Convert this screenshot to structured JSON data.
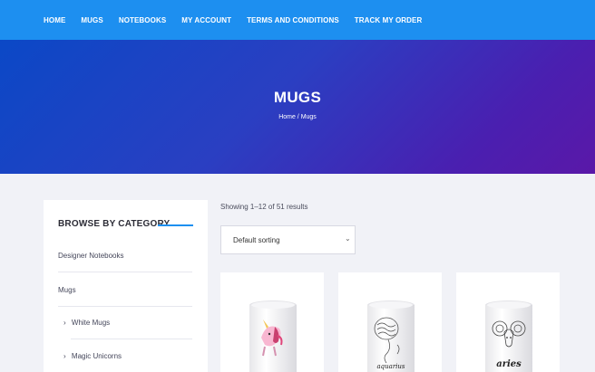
{
  "nav": {
    "items": [
      "HOME",
      "MUGS",
      "NOTEBOOKS",
      "MY ACCOUNT",
      "TERMS AND CONDITIONS",
      "TRACK MY ORDER"
    ]
  },
  "hero": {
    "title": "MUGS",
    "breadcrumb": "Home / Mugs"
  },
  "sidebar": {
    "title": "BROWSE BY CATEGORY",
    "items": [
      "Designer Notebooks",
      "Mugs",
      "White Mugs",
      "Magic Unicorns"
    ],
    "subitem_prefix": "›"
  },
  "shop": {
    "result_count": "Showing 1–12 of 51 results",
    "sort_selected": "Default sorting"
  },
  "products": [
    {
      "label": "",
      "icon": "unicorn-mug-icon"
    },
    {
      "label": "aquarius",
      "icon": "aquarius-mug-icon"
    },
    {
      "label": "aries",
      "icon": "aries-mug-icon"
    }
  ],
  "colors": {
    "nav_bg": "#1d8ff0",
    "hero_start": "#0b48c6",
    "hero_end": "#5a18a8",
    "page_bg": "#f1f2f7",
    "accent_line": "#1d8ff0"
  }
}
